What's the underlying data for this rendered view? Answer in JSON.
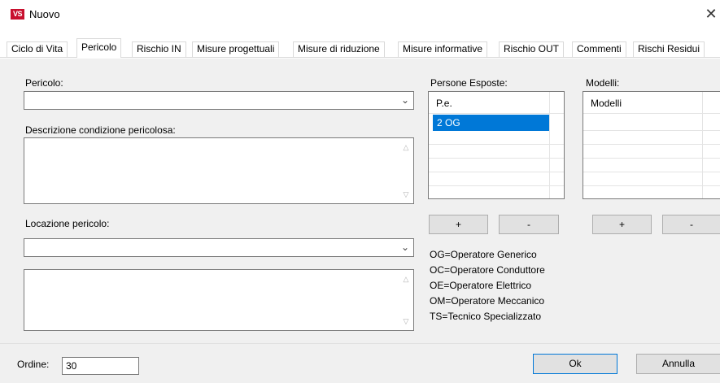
{
  "window": {
    "icon_text": "VS",
    "title": "Nuovo",
    "close_glyph": "✕"
  },
  "tabs": [
    {
      "label": "Ciclo di Vita"
    },
    {
      "label": "Pericolo",
      "active": true
    },
    {
      "label": "Rischio IN"
    },
    {
      "label": "Misure progettuali"
    },
    {
      "label": "Misure di riduzione"
    },
    {
      "label": "Misure informative"
    },
    {
      "label": "Rischio OUT"
    },
    {
      "label": "Commenti"
    },
    {
      "label": "Rischi Residui"
    }
  ],
  "form": {
    "pericolo_label": "Pericolo:",
    "pericolo_value": "",
    "descrizione_label": "Descrizione condizione pericolosa:",
    "descrizione_value": "",
    "locazione_label": "Locazione pericolo:",
    "locazione_value": "",
    "locazione_notes": ""
  },
  "persone": {
    "label": "Persone Esposte:",
    "header": "P.e.",
    "rows": [
      "2 OG"
    ],
    "add_label": "+",
    "remove_label": "-"
  },
  "modelli": {
    "label": "Modelli:",
    "header": "Modelli",
    "add_label": "+",
    "remove_label": "-"
  },
  "legend": [
    "OG=Operatore Generico",
    "OC=Operatore Conduttore",
    "OE=Operatore Elettrico",
    "OM=Operatore Meccanico",
    "TS=Tecnico Specializzato"
  ],
  "footer": {
    "ordine_label": "Ordine:",
    "ordine_value": "30",
    "ok_label": "Ok",
    "annulla_label": "Annulla"
  },
  "colors": {
    "selection": "#0078d7",
    "app_icon": "#c8102e",
    "dialog_bg": "#f0f0f0"
  }
}
